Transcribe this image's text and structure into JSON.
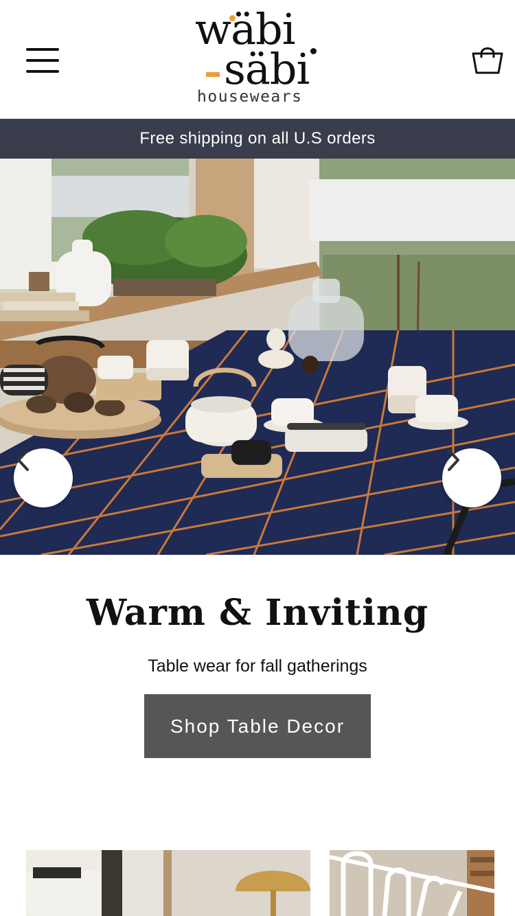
{
  "header": {
    "logo": {
      "line1": "wäbi",
      "line2": "säbi",
      "subtitle": "housewears"
    },
    "menu_icon": "hamburger-menu-icon",
    "cart_icon": "shopping-bag-icon"
  },
  "promo_bar": {
    "text": "Free shipping on all U.S orders"
  },
  "hero": {
    "image": "table-setting-photo",
    "prev_icon": "chevron-left-icon",
    "next_icon": "chevron-right-icon",
    "title": "Warm & Inviting",
    "subtitle": "Table wear for fall gatherings",
    "cta_label": "Shop Table Decor"
  },
  "colors": {
    "promo_bg": "#3a3d4c",
    "cta_bg": "#565656",
    "logo_accent": "#e8a13a",
    "tablecloth": "#1f2a55",
    "grid_lines": "#c9793a"
  },
  "tiles": [
    {
      "image": "living-room-lamp-photo"
    },
    {
      "image": "white-chair-photo"
    }
  ]
}
